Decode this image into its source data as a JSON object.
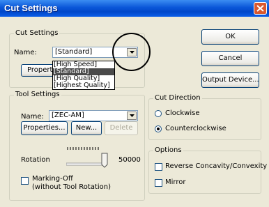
{
  "window": {
    "title": "Cut Settings"
  },
  "cut_settings": {
    "group_label": "Cut Settings",
    "name_label": "Name:",
    "name_value": "[Standard]",
    "properties_label": "Properties...",
    "dropdown_options": [
      "[High Speed]",
      "[Standard]",
      "[High Quality]",
      "[Highest Quality]"
    ],
    "selected_option": "[Standard]"
  },
  "tool_settings": {
    "group_label": "Tool Settings",
    "name_label": "Name:",
    "name_value": "[ZEC-AM]",
    "properties_label": "Properties...",
    "new_label": "New...",
    "delete_label": "Delete",
    "rotation_label": "Rotation",
    "rotation_value": "50000",
    "marking_off_line1": "Marking-Off",
    "marking_off_line2": "(without Tool Rotation)"
  },
  "buttons": {
    "ok": "OK",
    "cancel": "Cancel",
    "output_device": "Output Device..."
  },
  "cut_direction": {
    "group_label": "Cut Direction",
    "clockwise": "Clockwise",
    "counterclockwise": "Counterclockwise",
    "selected": "Counterclockwise"
  },
  "options": {
    "group_label": "Options",
    "reverse": "Reverse Concavity/Convexity",
    "mirror": "Mirror"
  }
}
